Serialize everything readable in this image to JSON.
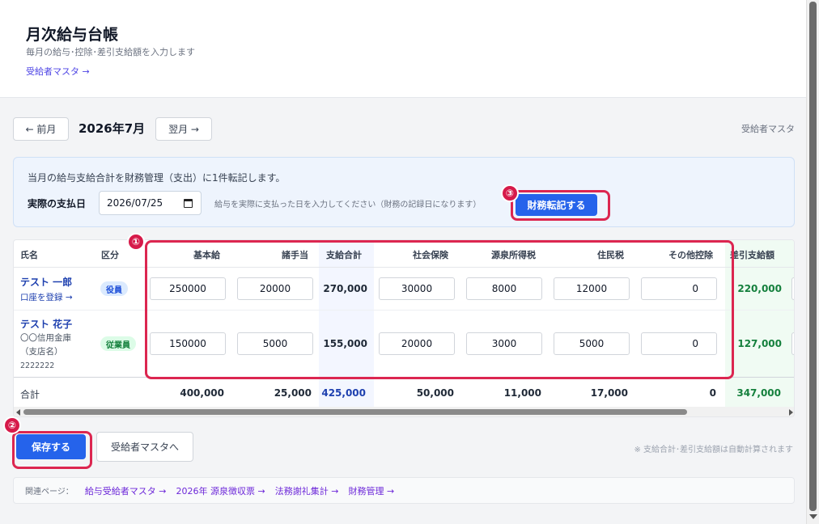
{
  "header": {
    "title": "月次給与台帳",
    "subtitle": "毎月の給与･控除･差引支給額を入力します",
    "link": "受給者マスタ →"
  },
  "month_nav": {
    "prev": "← 前月",
    "current": "2026年7月",
    "next": "翌月 →",
    "right_link": "受給者マスタ"
  },
  "transfer_panel": {
    "text": "当月の給与支給合計を財務管理（支出）に1件転記します。",
    "pay_date_label": "実際の支払日",
    "pay_date_value": "2026/07/25",
    "hint": "給与を実際に支払った日を入力してください（財務の記録日になります）",
    "transfer_button": "財務転記する"
  },
  "table": {
    "headers": {
      "name": "氏名",
      "category": "区分",
      "base": "基本給",
      "allowance": "諸手当",
      "total_pay": "支給合計",
      "social": "社会保険",
      "income_tax": "源泉所得税",
      "resident_tax": "住民税",
      "other": "その他控除",
      "net": "差引支給額"
    },
    "rows": [
      {
        "name": "テスト 一郎",
        "link": "口座を登録 →",
        "category": "役員",
        "base": "250000",
        "allowance": "20000",
        "total_pay": "270,000",
        "social": "30000",
        "income_tax": "8000",
        "resident_tax": "12000",
        "other": "0",
        "net": "220,000"
      },
      {
        "name": "テスト 花子",
        "bank": "〇〇信用金庫",
        "branch": "（支店名）",
        "account": "2222222",
        "category": "従業員",
        "base": "150000",
        "allowance": "5000",
        "total_pay": "155,000",
        "social": "20000",
        "income_tax": "3000",
        "resident_tax": "5000",
        "other": "0",
        "net": "127,000"
      }
    ],
    "totals": {
      "label": "合計",
      "base": "400,000",
      "allowance": "25,000",
      "total_pay": "425,000",
      "social": "50,000",
      "income_tax": "11,000",
      "resident_tax": "17,000",
      "other": "0",
      "net": "347,000"
    }
  },
  "actions": {
    "save": "保存する",
    "master": "受給者マスタへ",
    "note": "※ 支給合計･差引支給額は自動計算されます"
  },
  "related": {
    "label": "関連ページ：",
    "links": [
      "給与受給者マスタ →",
      "2026年 源泉徴収票 →",
      "法務謝礼集計 →",
      "財務管理 →"
    ]
  },
  "annotations": [
    "①",
    "②",
    "③"
  ],
  "colors": {
    "primary": "#2563eb",
    "callout": "#dc2650",
    "net_green": "#15803d",
    "link_purple": "#6d28d9"
  }
}
